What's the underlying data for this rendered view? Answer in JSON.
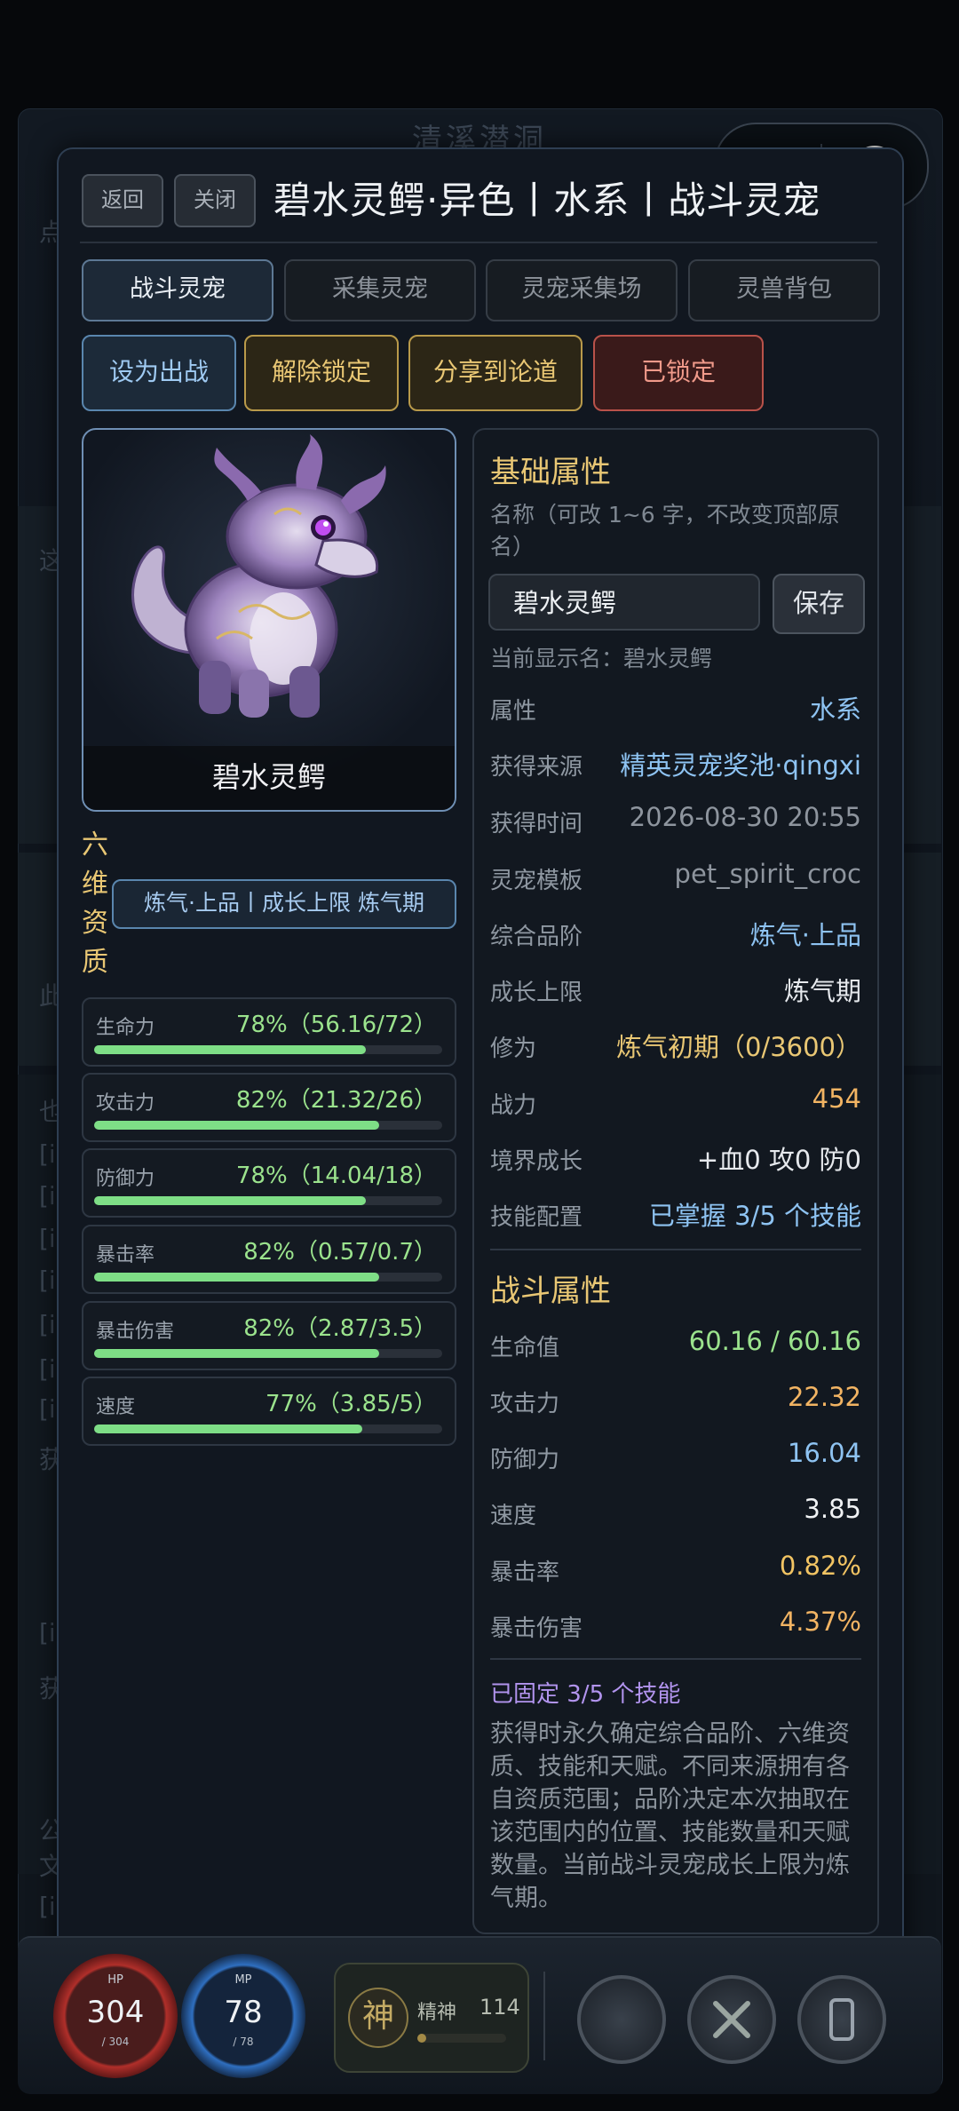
{
  "background": {
    "title": "清溪潜洞",
    "side_chars": [
      "点",
      "这",
      "此",
      "也",
      "[i",
      "[i",
      "[i",
      "[i",
      "[i",
      "[i",
      "[i",
      "获",
      "[i",
      "获",
      "公",
      "文",
      "[i"
    ]
  },
  "mini_program": {
    "menu_icon": "more-dots-icon",
    "close_icon": "target-close-icon"
  },
  "header": {
    "back_label": "返回",
    "close_label": "关闭",
    "title": "碧水灵鳄·异色丨水系丨战斗灵宠"
  },
  "tabs": [
    {
      "label": "战斗灵宠",
      "active": true
    },
    {
      "label": "采集灵宠",
      "active": false
    },
    {
      "label": "灵宠采集场",
      "active": false
    },
    {
      "label": "灵兽背包",
      "active": false
    }
  ],
  "actions": {
    "deploy": "设为出战",
    "unlock": "解除锁定",
    "share": "分享到论道",
    "locked": "已锁定"
  },
  "pet": {
    "display_name": "碧水灵鳄"
  },
  "six_dim": {
    "title": "六维资质",
    "badge": "炼气·上品丨成长上限 炼气期",
    "stats": [
      {
        "name": "生命力",
        "value": "78%（56.16/72）",
        "percent": 78
      },
      {
        "name": "攻击力",
        "value": "82%（21.32/26）",
        "percent": 82
      },
      {
        "name": "防御力",
        "value": "78%（14.04/18）",
        "percent": 78
      },
      {
        "name": "暴击率",
        "value": "82%（0.57/0.7）",
        "percent": 82
      },
      {
        "name": "暴击伤害",
        "value": "82%（2.87/3.5）",
        "percent": 82
      },
      {
        "name": "速度",
        "value": "77%（3.85/5）",
        "percent": 77
      }
    ]
  },
  "basic": {
    "title": "基础属性",
    "rename_hint": "名称（可改 1~6 字，不改变顶部原名）",
    "name_value": "碧水灵鳄",
    "save_label": "保存",
    "current_name": "当前显示名：碧水灵鳄",
    "rows": [
      {
        "key": "属性",
        "value": "水系",
        "color": "#8ec3f2"
      },
      {
        "key": "获得来源",
        "value": "精英灵宠奖池·qingxi",
        "color": "#8ec3f2"
      },
      {
        "key": "获得时间",
        "value": "2026-08-30 20:55",
        "color": "#8e959e"
      },
      {
        "key": "灵宠模板",
        "value": "pet_spirit_croc",
        "color": "#8e959e"
      },
      {
        "key": "综合品阶",
        "value": "炼气·上品",
        "color": "#8ec3f2"
      },
      {
        "key": "成长上限",
        "value": "炼气期",
        "color": "#e6e9ed"
      },
      {
        "key": "修为",
        "value": "炼气初期（0/3600）",
        "color": "#e9c774"
      },
      {
        "key": "战力",
        "value": "454",
        "color": "#f2b463"
      },
      {
        "key": "境界成长",
        "value": "+血0 攻0 防0",
        "color": "#e6e9ed"
      },
      {
        "key": "技能配置",
        "value": "已掌握 3/5 个技能",
        "color": "#8ec3f2"
      }
    ]
  },
  "combat": {
    "title": "战斗属性",
    "rows": [
      {
        "key": "生命值",
        "value": "60.16 / 60.16",
        "color": "#9be38d"
      },
      {
        "key": "攻击力",
        "value": "22.32",
        "color": "#f2b463"
      },
      {
        "key": "防御力",
        "value": "16.04",
        "color": "#8ec3f2"
      },
      {
        "key": "速度",
        "value": "3.85",
        "color": "#f0f2f4"
      },
      {
        "key": "暴击率",
        "value": "0.82%",
        "color": "#f2c463"
      },
      {
        "key": "暴击伤害",
        "value": "4.37%",
        "color": "#f2b463"
      }
    ]
  },
  "skills_fixed": "已固定 3/5 个技能",
  "description": "获得时永久确定综合品阶、六维资质、技能和天赋。不同来源拥有各自资质范围；品阶决定本次抽取在该范围内的位置、技能数量和天赋数量。当前战斗灵宠成长上限为炼气期。",
  "status_bar": {
    "hp": {
      "label": "HP",
      "value": "304",
      "max": "/ 304",
      "color": "#c0392b"
    },
    "mp": {
      "label": "MP",
      "value": "78",
      "max": "/ 78",
      "color": "#2f6fc0"
    },
    "spirit": {
      "char": "神",
      "label": "精神",
      "value": "114",
      "percent": 10
    },
    "icons": [
      "bag-icon",
      "swords-icon",
      "phone-icon"
    ]
  }
}
